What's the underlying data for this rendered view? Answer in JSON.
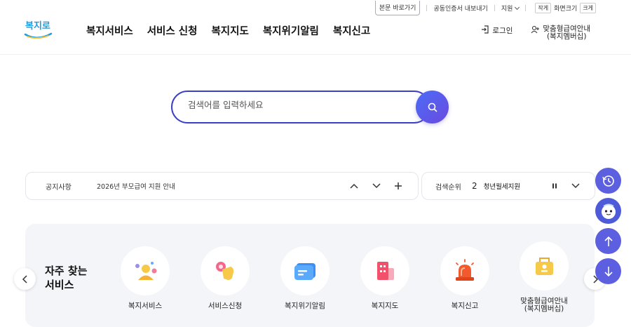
{
  "util": {
    "skip_link": "본문 바로가기",
    "cert_export": "공동인증서 내보내기",
    "region": "지원",
    "zoom_out": "작게",
    "zoom_label": "화면크기",
    "zoom_in": "크게"
  },
  "header": {
    "logo_text": "복지로",
    "nav": [
      "복지서비스",
      "서비스 신청",
      "복지지도",
      "복지위기알림",
      "복지신고"
    ],
    "login": "로그인",
    "member_line1": "맞춤형급여안내",
    "member_line2": "(복지멤버십)"
  },
  "search": {
    "placeholder": "검색어를 입력하세요"
  },
  "notice": {
    "label": "공지사항",
    "text": "2026년 부모급여 지원 안내"
  },
  "rank": {
    "label": "검색순위",
    "number": "2",
    "term": "청년월세지원"
  },
  "quick": {
    "title_line1": "자주 찾는",
    "title_line2": "서비스",
    "items": [
      {
        "label": "복지서비스",
        "icon": "person-icon"
      },
      {
        "label": "서비스신청",
        "icon": "hand-tap-icon"
      },
      {
        "label": "복지위기알림",
        "icon": "message-icon"
      },
      {
        "label": "복지지도",
        "icon": "building-icon"
      },
      {
        "label": "복지신고",
        "icon": "siren-icon"
      },
      {
        "label_line1": "맞춤형급여안내",
        "label_line2": "(복지멤버십)",
        "icon": "membership-icon"
      }
    ]
  },
  "colors": {
    "accent": "#3b3fc8",
    "float_button": "#5b5fe0"
  }
}
